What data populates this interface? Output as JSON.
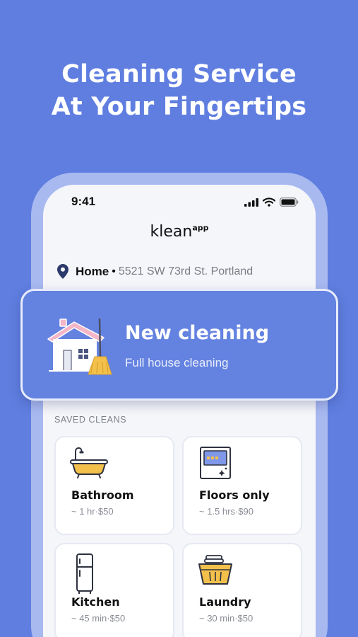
{
  "headline": {
    "line1": "Cleaning Service",
    "line2": "At Your Fingertips"
  },
  "status_bar": {
    "time": "9:41"
  },
  "brand": {
    "name": "klean",
    "sup": "app"
  },
  "address": {
    "label": "Home",
    "separator": "•",
    "street": "5521 SW 73rd St. Portland"
  },
  "new_cleaning": {
    "title": "New cleaning",
    "subtitle": "Full house cleaning"
  },
  "saved": {
    "label": "SAVED CLEANS",
    "items": [
      {
        "name": "Bathroom",
        "meta": "~ 1 hr·$50",
        "icon": "bathtub-icon"
      },
      {
        "name": "Floors only",
        "meta": "~ 1.5 hrs·$90",
        "icon": "floor-icon"
      },
      {
        "name": "Kitchen",
        "meta": "~ 45 min·$50",
        "icon": "fridge-icon"
      },
      {
        "name": "Laundry",
        "meta": "~ 30 min·$50",
        "icon": "laundry-basket-icon"
      }
    ]
  },
  "colors": {
    "background": "#5f7ee0",
    "card": "#6482e0",
    "accent": "#f3c04c",
    "pin": "#2c3a6b"
  }
}
